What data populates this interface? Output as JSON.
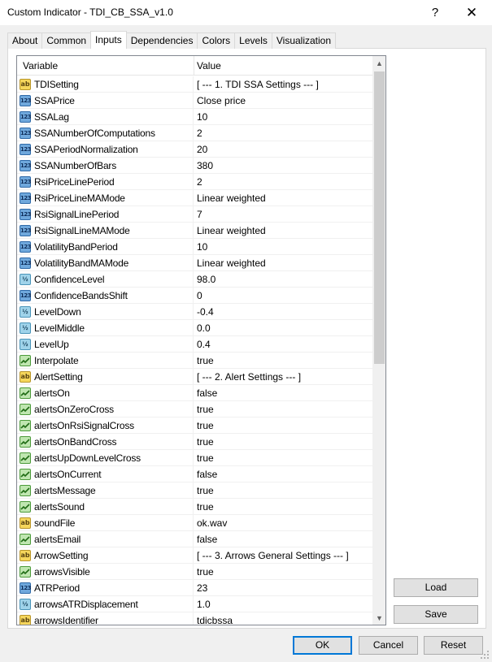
{
  "window": {
    "title": "Custom Indicator - TDI_CB_SSA_v1.0",
    "help_glyph": "?",
    "close_glyph": "✕"
  },
  "tabs": [
    "About",
    "Common",
    "Inputs",
    "Dependencies",
    "Colors",
    "Levels",
    "Visualization"
  ],
  "active_tab": "Inputs",
  "grid": {
    "col_variable": "Variable",
    "col_value": "Value",
    "rows": [
      {
        "icon": "ab",
        "name": "TDISetting",
        "value": "[ --- 1. TDI SSA Settings --- ]"
      },
      {
        "icon": "123",
        "name": "SSAPrice",
        "value": "Close price"
      },
      {
        "icon": "123",
        "name": "SSALag",
        "value": "10"
      },
      {
        "icon": "123",
        "name": "SSANumberOfComputations",
        "value": "2"
      },
      {
        "icon": "123",
        "name": "SSAPeriodNormalization",
        "value": "20"
      },
      {
        "icon": "123",
        "name": "SSANumberOfBars",
        "value": "380"
      },
      {
        "icon": "123",
        "name": "RsiPriceLinePeriod",
        "value": "2"
      },
      {
        "icon": "123",
        "name": "RsiPriceLineMAMode",
        "value": "Linear weighted"
      },
      {
        "icon": "123",
        "name": "RsiSignalLinePeriod",
        "value": "7"
      },
      {
        "icon": "123",
        "name": "RsiSignalLineMAMode",
        "value": "Linear weighted"
      },
      {
        "icon": "123",
        "name": "VolatilityBandPeriod",
        "value": "10"
      },
      {
        "icon": "123",
        "name": "VolatilityBandMAMode",
        "value": "Linear weighted"
      },
      {
        "icon": "1/2",
        "name": "ConfidenceLevel",
        "value": "98.0"
      },
      {
        "icon": "123",
        "name": "ConfidenceBandsShift",
        "value": "0"
      },
      {
        "icon": "1/2",
        "name": "LevelDown",
        "value": "-0.4"
      },
      {
        "icon": "1/2",
        "name": "LevelMiddle",
        "value": "0.0"
      },
      {
        "icon": "1/2",
        "name": "LevelUp",
        "value": "0.4"
      },
      {
        "icon": "bool",
        "name": "Interpolate",
        "value": "true"
      },
      {
        "icon": "ab",
        "name": "AlertSetting",
        "value": "[ --- 2. Alert Settings --- ]"
      },
      {
        "icon": "bool",
        "name": "alertsOn",
        "value": "false"
      },
      {
        "icon": "bool",
        "name": "alertsOnZeroCross",
        "value": "true"
      },
      {
        "icon": "bool",
        "name": "alertsOnRsiSignalCross",
        "value": "true"
      },
      {
        "icon": "bool",
        "name": "alertsOnBandCross",
        "value": "true"
      },
      {
        "icon": "bool",
        "name": "alertsUpDownLevelCross",
        "value": "true"
      },
      {
        "icon": "bool",
        "name": "alertsOnCurrent",
        "value": "false"
      },
      {
        "icon": "bool",
        "name": "alertsMessage",
        "value": "true"
      },
      {
        "icon": "bool",
        "name": "alertsSound",
        "value": "true"
      },
      {
        "icon": "ab",
        "name": "soundFile",
        "value": "ok.wav"
      },
      {
        "icon": "bool",
        "name": "alertsEmail",
        "value": "false"
      },
      {
        "icon": "ab",
        "name": "ArrowSetting",
        "value": "[ --- 3. Arrows General Settings --- ]"
      },
      {
        "icon": "bool",
        "name": "arrowsVisible",
        "value": "true"
      },
      {
        "icon": "123",
        "name": "ATRPeriod",
        "value": "23"
      },
      {
        "icon": "1/2",
        "name": "arrowsATRDisplacement",
        "value": "1.0"
      },
      {
        "icon": "ab",
        "name": "arrowsIdentifier",
        "value": "tdicbssa"
      }
    ]
  },
  "buttons": {
    "load": "Load",
    "save": "Save",
    "ok": "OK",
    "cancel": "Cancel",
    "reset": "Reset"
  },
  "colors": {
    "accent": "#0078d7",
    "icon_string": "#f5d65c",
    "icon_integer": "#6fa8dc",
    "icon_double": "#9fd3ea",
    "icon_bool": "#bfe6b0"
  }
}
